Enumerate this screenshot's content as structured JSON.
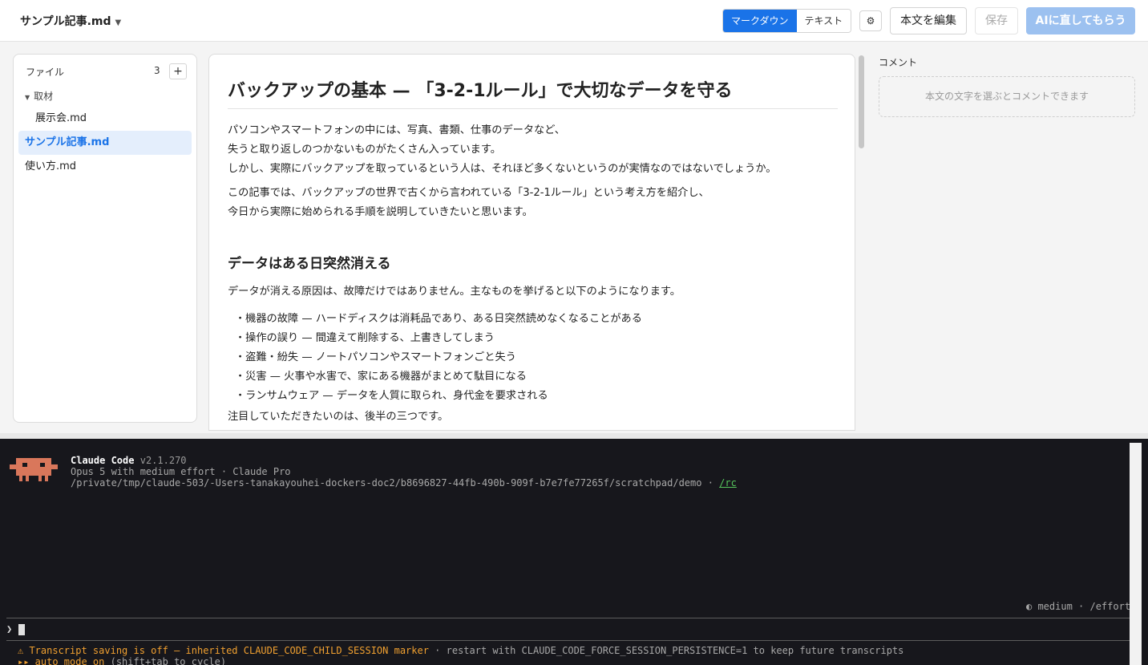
{
  "topbar": {
    "doc_title": "サンプル記事.md",
    "doc_caret": "▼",
    "view_modes": [
      "マークダウン",
      "テキスト"
    ],
    "gear_glyph": "⚙",
    "edit_label": "本文を編集",
    "save_label": "保存",
    "ai_label": "AIに直してもらう",
    "accent": "#1a73e8"
  },
  "sidebar": {
    "heading": "ファイル",
    "count": "3",
    "add_glyph": "+",
    "folder": "取材",
    "items": [
      {
        "label": "展示会.md"
      },
      {
        "label": "サンプル記事.md"
      },
      {
        "label": "使い方.md"
      }
    ]
  },
  "editor": {
    "title": "バックアップの基本 — 「3-2-1ルール」で大切なデータを守る",
    "para1": [
      "パソコンやスマートフォンの中には、写真、書類、仕事のデータなど、",
      "失うと取り返しのつかないものがたくさん入っています。",
      "しかし、実際にバックアップを取っているという人は、それほど多くないというのが実情なのではないでしょうか。"
    ],
    "para2": [
      "この記事では、バックアップの世界で古くから言われている「3-2-1ルール」という考え方を紹介し、",
      "今日から実際に始められる手順を説明していきたいと思います。"
    ],
    "heading2": "データはある日突然消える",
    "para3": "データが消える原因は、故障だけではありません。主なものを挙げると以下のようになります。",
    "list": [
      "・機器の故障 — ハードディスクは消耗品であり、ある日突然読めなくなることがある",
      "・操作の誤り — 間違えて削除する、上書きしてしまう",
      "・盗難・紛失 — ノートパソコンやスマートフォンごと失う",
      "・災害 — 火事や水害で、家にある機器がまとめて駄目になる",
      "・ランサムウェア — データを人質に取られ、身代金を要求される"
    ],
    "para4": "注目していただきたいのは、後半の三つです。"
  },
  "comments": {
    "label": "コメント",
    "placeholder": "本文の文字を選ぶとコメントできます"
  },
  "terminal": {
    "app_name": "Claude Code",
    "version": "v2.1.270",
    "model_line": "Opus 5 with medium effort · Claude Pro",
    "path": "/private/tmp/claude-503/-Users-tanakayouhei-dockers-doc2/b8696827-44fb-490b-909f-b7e7fe77265f/scratchpad/demo · ",
    "rc_link": "/rc",
    "effort_status": "◐ medium · /effort",
    "prompt_glyph": "❯",
    "warning_main": "⚠ Transcript saving is off — inherited CLAUDE_CODE_CHILD_SESSION marker",
    "warning_rest": " · restart with CLAUDE_CODE_FORCE_SESSION_PERSISTENCE=1 to keep future transcripts",
    "auto_mode": "▸▸ auto mode on",
    "auto_hint": " (shift+tab to cycle)",
    "logo_color": "#d9775b",
    "warning_color": "#f0a030"
  }
}
